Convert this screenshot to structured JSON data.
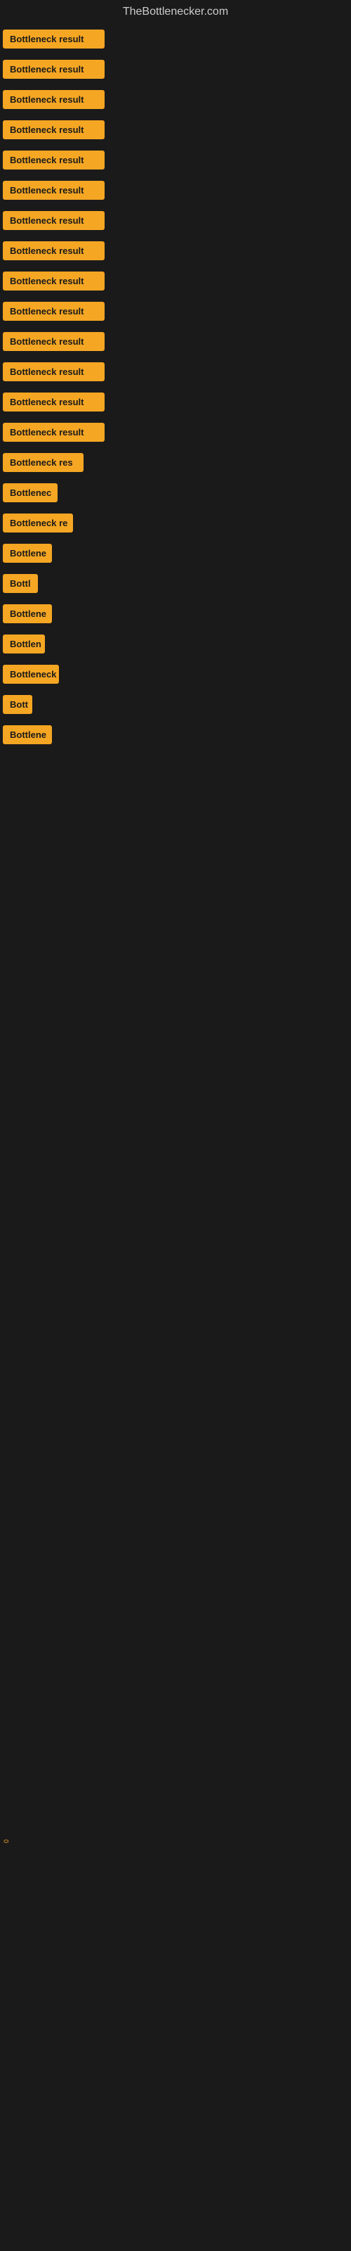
{
  "site": {
    "title": "TheBottlenecker.com"
  },
  "bars": [
    {
      "id": 1,
      "label": "Bottleneck result",
      "width": 145
    },
    {
      "id": 2,
      "label": "Bottleneck result",
      "width": 145
    },
    {
      "id": 3,
      "label": "Bottleneck result",
      "width": 145
    },
    {
      "id": 4,
      "label": "Bottleneck result",
      "width": 145
    },
    {
      "id": 5,
      "label": "Bottleneck result",
      "width": 145
    },
    {
      "id": 6,
      "label": "Bottleneck result",
      "width": 145
    },
    {
      "id": 7,
      "label": "Bottleneck result",
      "width": 145
    },
    {
      "id": 8,
      "label": "Bottleneck result",
      "width": 145
    },
    {
      "id": 9,
      "label": "Bottleneck result",
      "width": 145
    },
    {
      "id": 10,
      "label": "Bottleneck result",
      "width": 145
    },
    {
      "id": 11,
      "label": "Bottleneck result",
      "width": 145
    },
    {
      "id": 12,
      "label": "Bottleneck result",
      "width": 145
    },
    {
      "id": 13,
      "label": "Bottleneck result",
      "width": 145
    },
    {
      "id": 14,
      "label": "Bottleneck result",
      "width": 145
    },
    {
      "id": 15,
      "label": "Bottleneck res",
      "width": 115
    },
    {
      "id": 16,
      "label": "Bottlenec",
      "width": 78
    },
    {
      "id": 17,
      "label": "Bottleneck re",
      "width": 100
    },
    {
      "id": 18,
      "label": "Bottlene",
      "width": 70
    },
    {
      "id": 19,
      "label": "Bottl",
      "width": 50
    },
    {
      "id": 20,
      "label": "Bottlene",
      "width": 70
    },
    {
      "id": 21,
      "label": "Bottlen",
      "width": 60
    },
    {
      "id": 22,
      "label": "Bottleneck",
      "width": 80
    },
    {
      "id": 23,
      "label": "Bott",
      "width": 42
    },
    {
      "id": 24,
      "label": "Bottlene",
      "width": 70
    }
  ],
  "bottom_label": "0"
}
